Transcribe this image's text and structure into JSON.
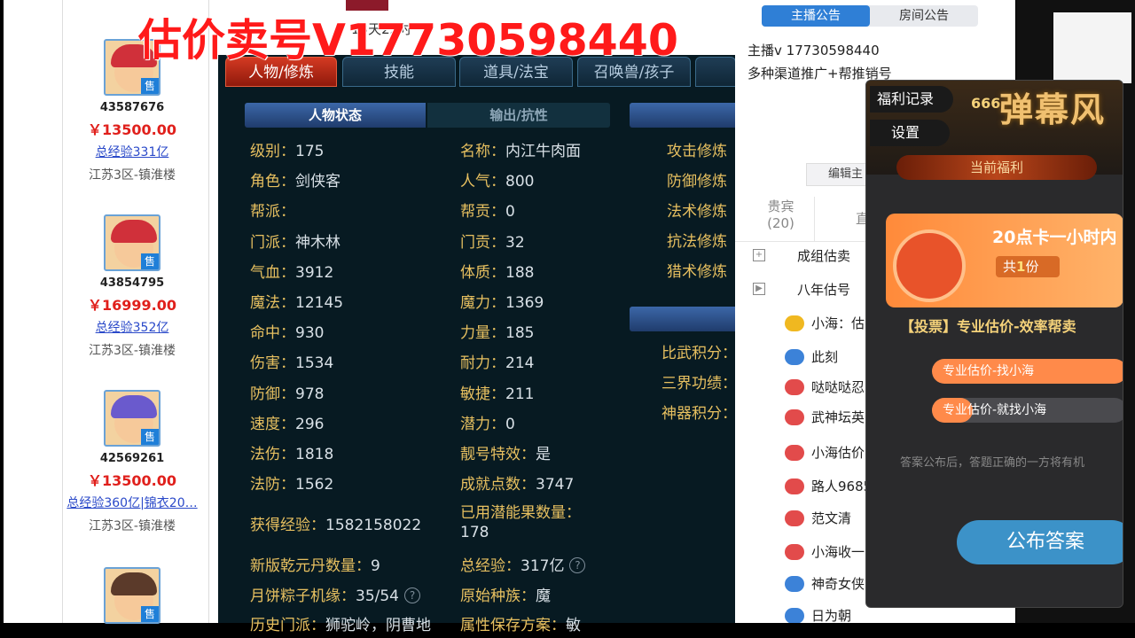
{
  "watermark": "估价卖号V17730598440",
  "listing": [
    {
      "id": "43587676",
      "price": "￥13500.00",
      "exp": "总经验331亿",
      "server": "江苏3区-镇淮楼",
      "sale": "售"
    },
    {
      "id": "43854795",
      "price": "￥16999.00",
      "exp": "总经验352亿",
      "server": "江苏3区-镇淮楼",
      "sale": "售"
    },
    {
      "id": "42569261",
      "price": "￥13500.00",
      "exp": "总经验360亿|锦衣20…",
      "server": "江苏3区-镇淮楼",
      "sale": "售"
    },
    {
      "id": "",
      "price": "",
      "exp": "",
      "server": "",
      "sale": "售"
    }
  ],
  "game": {
    "top_text": "13天22时",
    "tabs": [
      "人物/修炼",
      "技能",
      "道具/法宝",
      "召唤兽/孩子",
      ""
    ],
    "sub_tabs": [
      "人物状态",
      "输出/抗性"
    ],
    "stats_left": [
      {
        "k": "级别：",
        "v": "175"
      },
      {
        "k": "角色：",
        "v": "剑侠客"
      },
      {
        "k": "帮派：",
        "v": ""
      },
      {
        "k": "门派：",
        "v": "神木林"
      },
      {
        "k": "气血：",
        "v": "3912"
      },
      {
        "k": "魔法：",
        "v": "12145"
      },
      {
        "k": "命中：",
        "v": "930"
      },
      {
        "k": "伤害：",
        "v": "1534"
      },
      {
        "k": "防御：",
        "v": "978"
      },
      {
        "k": "速度：",
        "v": "296"
      },
      {
        "k": "法伤：",
        "v": "1818"
      },
      {
        "k": "法防：",
        "v": "1562"
      }
    ],
    "stats_mid": [
      {
        "k": "名称：",
        "v": "内江牛肉面"
      },
      {
        "k": "人气：",
        "v": "800"
      },
      {
        "k": "帮贡：",
        "v": "0"
      },
      {
        "k": "门贡：",
        "v": "32"
      },
      {
        "k": "体质：",
        "v": "188"
      },
      {
        "k": "魔力：",
        "v": "1369"
      },
      {
        "k": "力量：",
        "v": "185"
      },
      {
        "k": "耐力：",
        "v": "214"
      },
      {
        "k": "敏捷：",
        "v": "211"
      },
      {
        "k": "潜力：",
        "v": "0"
      },
      {
        "k": "靓号特效：",
        "v": "是"
      },
      {
        "k": "成就点数：",
        "v": "3747"
      }
    ],
    "exp_k": "获得经验：",
    "exp_v": "1582158022",
    "potion_k": "已用潜能果数量：",
    "potion_v": "178",
    "dan_k": "新版乾元丹数量：",
    "dan_v": "9",
    "total_k": "总经验：",
    "total_v": "317亿",
    "cake_k": "月饼粽子机缘：",
    "cake_v": "35/54",
    "race_k": "原始种族：",
    "race_v": "魔",
    "history_k": "历史门派：",
    "history_v": "狮驼岭，阴曹地",
    "attr_k": "属性保存方案：",
    "attr_v": "敏",
    "cultivation": [
      "攻击修炼",
      "防御修炼",
      "法术修炼",
      "抗法修炼",
      "猎术修炼"
    ],
    "scores": [
      "比武积分：",
      "三界功绩：",
      "神器积分："
    ],
    "help": "?"
  },
  "chat": {
    "tab_anchor": "主播公告",
    "tab_room": "房间公告",
    "anchor_line": "主播v 17730598440",
    "promo_line": "多种渠道推广+帮推销号",
    "edit": "编辑主",
    "vip_label": "贵宾",
    "vip_count": "(20)",
    "other": "直",
    "items": [
      "成组估卖",
      "八年估号",
      "小海：估",
      "此刻",
      "哒哒哒忍",
      "武神坛英",
      "小海估价",
      "路人9685",
      "范文清",
      "小海收一",
      "神奇女侠",
      "日为朝"
    ]
  },
  "popup": {
    "btn_record": "福利记录",
    "btn_settings": "设置",
    "brand": "666",
    "banner": "弹幕风",
    "current": "当前福利",
    "gift_title": "20点卡一小时内",
    "gift_count_pre": "共",
    "gift_count_num": "1",
    "gift_count_suf": "份",
    "vote": "【投票】专业估价-效率帮卖",
    "opt1": "专业估价-找小海",
    "opt2": "专业估价-就找小海",
    "note": "答案公布后，答题正确的一方将有机",
    "publish": "公布答案"
  },
  "colors": {
    "price": "#e0201c",
    "accent": "#2f7fd6",
    "gold": "#e7c060"
  }
}
